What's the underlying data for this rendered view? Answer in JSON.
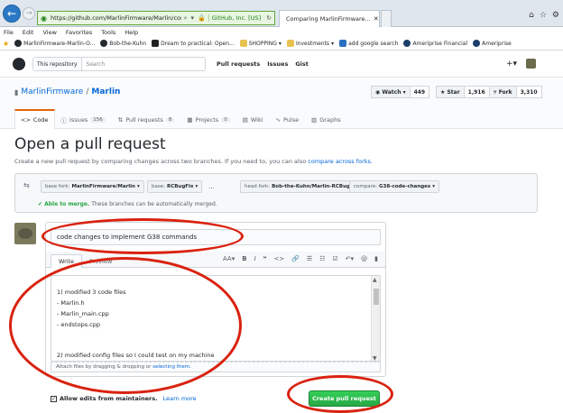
{
  "browser": {
    "url": "https://github.com/MarlinFirmware/Marlin/compare/RCE",
    "site_identity": "GitHub, Inc. [US]",
    "tabs": [
      {
        "label": "Comparing MarlinFirmware..."
      }
    ],
    "menu": [
      "File",
      "Edit",
      "View",
      "Favorites",
      "Tools",
      "Help"
    ],
    "favorites": [
      "MarlinFirmware-Marlin-O...",
      "Bob-the-Kuhn",
      "Dream to practical: Open...",
      "SHOPPING",
      "Investments",
      "add google search",
      "Ameriprise Financial",
      "Ameriprise"
    ]
  },
  "github_header": {
    "search_scope": "This repository",
    "search_placeholder": "Search",
    "nav": [
      "Pull requests",
      "Issues",
      "Gist"
    ],
    "plus_label": "+▾"
  },
  "repo": {
    "owner": "MarlinFirmware",
    "separator": "/",
    "name": "Marlin",
    "watch": {
      "label": "◉ Watch ▾",
      "count": "449"
    },
    "star": {
      "label": "★ Star",
      "count": "1,916"
    },
    "fork": {
      "label": "⑂ Fork",
      "count": "3,310"
    },
    "tabs": [
      {
        "icon": "<>",
        "label": "Code",
        "count": ""
      },
      {
        "icon": "ⓘ",
        "label": "Issues",
        "count": "156"
      },
      {
        "icon": "⇅",
        "label": "Pull requests",
        "count": "8"
      },
      {
        "icon": "▦",
        "label": "Projects",
        "count": "0"
      },
      {
        "icon": "▤",
        "label": "Wiki",
        "count": ""
      },
      {
        "icon": "∿",
        "label": "Pulse",
        "count": ""
      },
      {
        "icon": "▥",
        "label": "Graphs",
        "count": ""
      }
    ]
  },
  "compare": {
    "title": "Open a pull request",
    "subtitle_prefix": "Create a new pull request by comparing changes across two branches. If you need to, you can also",
    "subtitle_link": "compare across forks.",
    "base_fork": {
      "prefix": "base fork:",
      "value": "MarlinFirmware/Marlin"
    },
    "base": {
      "prefix": "base:",
      "value": "RCBugFix"
    },
    "dots": "...",
    "head_fork": {
      "prefix": "head fork:",
      "value": "Bob-the-Kuhn/Marlin-RCBugFi..."
    },
    "compare_branch": {
      "prefix": "compare:",
      "value": "G38-code-changes"
    },
    "merge_status_strong": "✔ Able to merge.",
    "merge_status_rest": "These branches can be automatically merged."
  },
  "form": {
    "title_value": "code changes to implement G38 commands",
    "tab_write": "Write",
    "tab_preview": "Preview",
    "toolbar": [
      "AA▾",
      "B",
      "I",
      "❝",
      "<>",
      "🔗",
      "☰",
      "☷",
      "☑",
      "↶▾",
      "@",
      "▮"
    ],
    "body_lines": [
      "1) modified 3 code files",
      "- Marlin.h",
      "- Marlin_main.cpp",
      "- endstops.cpp",
      "",
      "",
      "2) modified config files so I could test on my machine",
      ""
    ],
    "attach_prefix": "Attach files by dragging & dropping or",
    "attach_link": "selecting them.",
    "allow_edits_label": "Allow edits from maintainers.",
    "learn_more": "Learn more",
    "submit_label": "Create pull request"
  },
  "colors": {
    "accent_link": "#0366d6",
    "annotation_red": "#d9220f",
    "success_green": "#28a745"
  }
}
